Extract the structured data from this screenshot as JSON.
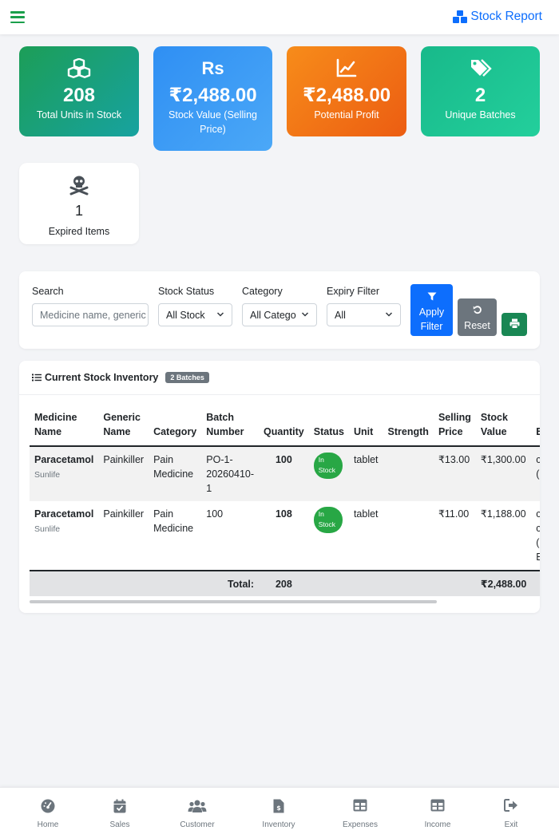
{
  "header": {
    "title": "Stock Report"
  },
  "summary": {
    "total_units": {
      "value": "208",
      "label": "Total Units in Stock"
    },
    "stock_value": {
      "value": "₹2,488.00",
      "label": "Stock Value (Selling Price)",
      "icon": "Rs"
    },
    "potential_profit": {
      "value": "₹2,488.00",
      "label": "Potential Profit"
    },
    "unique_batches": {
      "value": "2",
      "label": "Unique Batches"
    },
    "expired_items": {
      "value": "1",
      "label": "Expired Items"
    }
  },
  "filters": {
    "search_label": "Search",
    "search_placeholder": "Medicine name, generic",
    "stock_status_label": "Stock Status",
    "stock_status_value": "All Stock",
    "category_label": "Category",
    "category_value": "All Catego",
    "expiry_label": "Expiry Filter",
    "expiry_value": "All",
    "apply_line1": "Apply",
    "apply_line2": "Filter",
    "reset_label": "Reset"
  },
  "table": {
    "title": "Current Stock Inventory",
    "badge": "2 Batches",
    "columns": {
      "medicine_1": "Medicine",
      "medicine_2": "Name",
      "generic_1": "Generic",
      "generic_2": "Name",
      "category": "Category",
      "batch_1": "Batch",
      "batch_2": "Number",
      "quantity": "Quantity",
      "status": "Status",
      "unit": "Unit",
      "strength": "Strength",
      "selling_1": "Selling",
      "selling_2": "Price",
      "stockval_1": "Stock",
      "stockval_2": "Value",
      "next_1": "E"
    },
    "rows": [
      {
        "name": "Paracetamol",
        "brand": "Sunlife",
        "generic": "Painkiller",
        "category_1": "Pain",
        "category_2": "Medicine",
        "batch_1": "PO-1-",
        "batch_2": "20260410-",
        "batch_3": "1",
        "quantity": "100",
        "status_1": "In",
        "status_2": "Stock",
        "unit": "tablet",
        "strength": "",
        "selling_price": "₹13.00",
        "stock_value": "₹1,300.00",
        "next_1": "c",
        "next_2": "("
      },
      {
        "name": "Paracetamol",
        "brand": "Sunlife",
        "generic": "Painkiller",
        "category_1": "Pain",
        "category_2": "Medicine",
        "batch_1": "100",
        "batch_2": "",
        "batch_3": "",
        "quantity": "108",
        "status_1": "In",
        "status_2": "Stock",
        "unit": "tablet",
        "strength": "",
        "selling_price": "₹11.00",
        "stock_value": "₹1,188.00",
        "next_1": "c",
        "next_2": "c",
        "next_3": "(",
        "next_4": "E"
      }
    ],
    "footer": {
      "total_label": "Total:",
      "total_quantity": "208",
      "total_value": "₹2,488.00"
    }
  },
  "nav": {
    "items": [
      {
        "label": "Home",
        "icon": "gauge-icon"
      },
      {
        "label": "Sales",
        "icon": "calendar-check-icon"
      },
      {
        "label": "Customer",
        "icon": "users-icon"
      },
      {
        "label": "Inventory",
        "icon": "invoice-icon"
      },
      {
        "label": "Expenses",
        "icon": "table-icon"
      },
      {
        "label": "Income",
        "icon": "table-icon"
      },
      {
        "label": "Exit",
        "icon": "sign-out-icon"
      }
    ]
  },
  "colors": {
    "primary": "#0d6efd",
    "success": "#198754",
    "pill": "#28a745",
    "card_green": "#1c9e57",
    "card_blue": "#2f8ff3",
    "card_orange": "#f78c1a",
    "card_teal": "#18b98a"
  }
}
